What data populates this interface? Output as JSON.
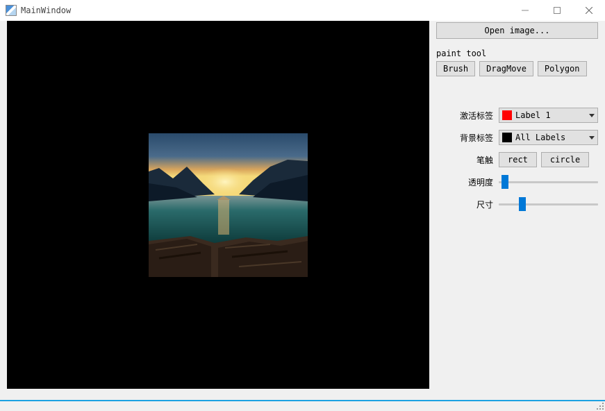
{
  "window": {
    "title": "MainWindow"
  },
  "buttons": {
    "open_image": "Open image...",
    "brush": "Brush",
    "dragmove": "DragMove",
    "polygon": "Polygon",
    "rect": "rect",
    "circle": "circle"
  },
  "labels": {
    "paint_tool": "paint tool",
    "active_label": "激活标签",
    "bg_label": "背景标签",
    "brush_shape": "笔触",
    "opacity": "透明度",
    "size": "尺寸"
  },
  "selects": {
    "active_label": {
      "text": "Label 1",
      "color": "#ff0000"
    },
    "bg_label": {
      "text": "All Labels",
      "color": "#000000"
    }
  },
  "sliders": {
    "opacity_pct": 3,
    "size_pct": 20
  }
}
